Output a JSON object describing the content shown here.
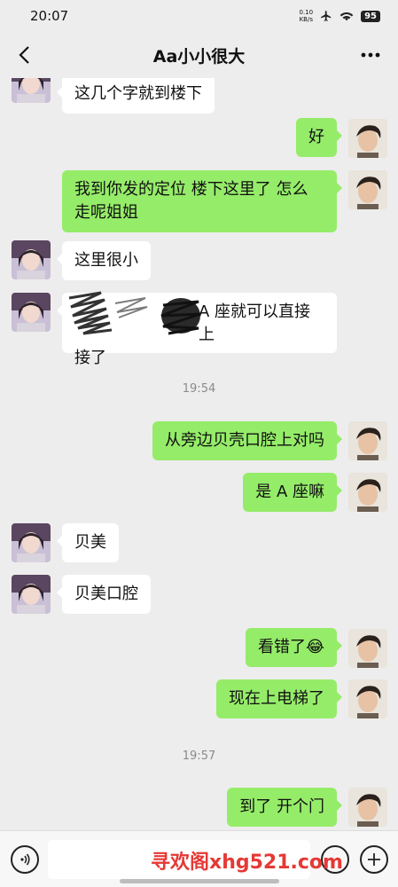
{
  "status_bar": {
    "time": "20:07",
    "netspeed_value": "0.10",
    "netspeed_unit": "KB/s",
    "battery": "95"
  },
  "header": {
    "title": "Aa小小很大"
  },
  "messages": [
    {
      "side": "left",
      "text": "这几个字就到楼下"
    },
    {
      "side": "right",
      "text": "好"
    },
    {
      "side": "right",
      "text_line1": "我到你发的定位 楼下这里了 怎么",
      "text_line2": "走呢姐姐"
    },
    {
      "side": "left",
      "text": "这里很小"
    },
    {
      "side": "left",
      "text_line1": "A 座就可以直接上",
      "text_line2": "接了"
    },
    {
      "side": "right",
      "text": "从旁边贝壳口腔上对吗"
    },
    {
      "side": "right",
      "text": "是 A 座嘛"
    },
    {
      "side": "left",
      "text": "贝美"
    },
    {
      "side": "left",
      "text": "贝美口腔"
    },
    {
      "side": "right",
      "text": "看错了😂"
    },
    {
      "side": "right",
      "text": "现在上电梯了"
    },
    {
      "side": "right",
      "text": "到了 开个门"
    }
  ],
  "timestamps": [
    "19:54",
    "19:57"
  ],
  "watermark": "寻欢阁xhg521.com",
  "colors": {
    "background": "#ededed",
    "sent_bubble": "#95ec69",
    "received_bubble": "#ffffff",
    "watermark": "#e53935"
  },
  "icons": {
    "back": "chevron-left-icon",
    "more": "more-dots-icon",
    "voice": "voice-icon",
    "emoji": "emoji-icon",
    "plus": "plus-icon"
  }
}
